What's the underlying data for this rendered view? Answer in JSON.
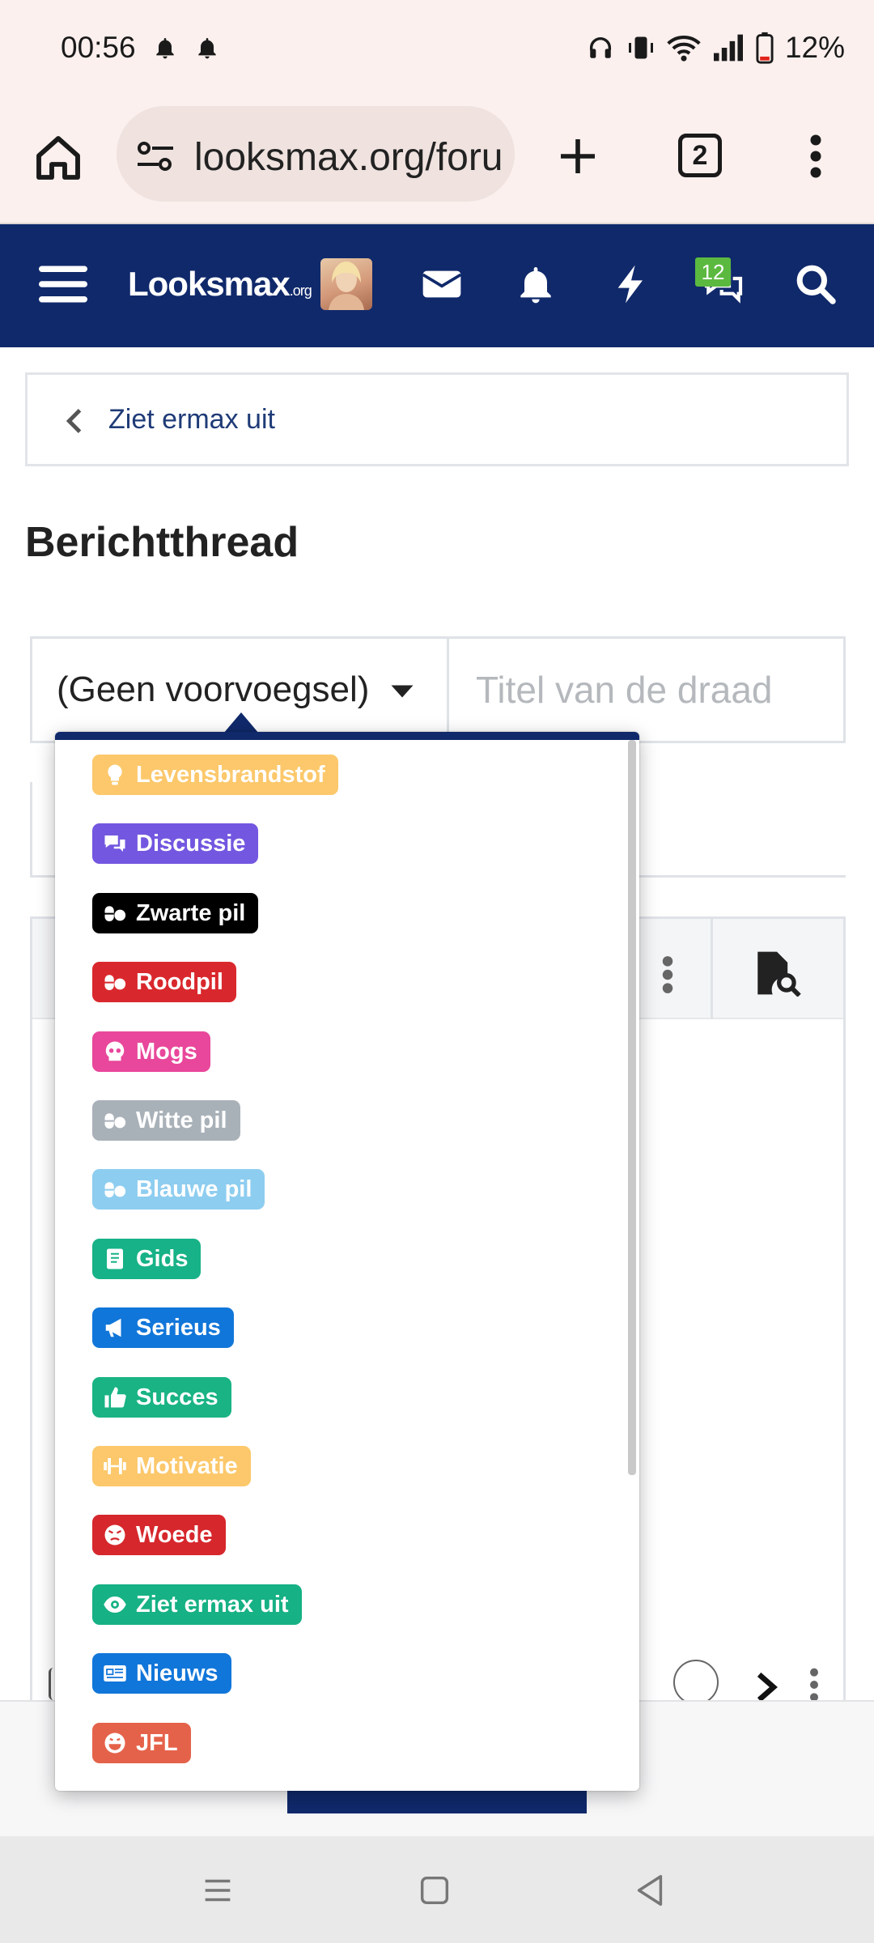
{
  "status_bar": {
    "time": "00:56",
    "battery": "12%"
  },
  "browser": {
    "url": "looksmax.org/foru",
    "tab_count": "2"
  },
  "site": {
    "logo": "Looksmax",
    "logo_suffix": ".org",
    "messages_badge": "12"
  },
  "breadcrumb": {
    "label": "Ziet ermax uit"
  },
  "page": {
    "title": "Berichtthread"
  },
  "form": {
    "prefix_value": "(Geen voorvoegsel)",
    "title_placeholder": "Titel van de draad"
  },
  "prefix_options": [
    {
      "label": "Levensbrandstof",
      "color": "#fcc86b",
      "icon": "lightbulb-icon"
    },
    {
      "label": "Discussie",
      "color": "#7357e0",
      "icon": "comments-icon"
    },
    {
      "label": "Zwarte pil",
      "color": "#000000",
      "icon": "pills-icon"
    },
    {
      "label": "Roodpil",
      "color": "#d9282d",
      "icon": "pills-icon"
    },
    {
      "label": "Mogs",
      "color": "#e8479b",
      "icon": "skull-icon"
    },
    {
      "label": "Witte pil",
      "color": "#a9b1b8",
      "icon": "pills-icon"
    },
    {
      "label": "Blauwe pil",
      "color": "#8dcdf0",
      "icon": "pills-icon"
    },
    {
      "label": "Gids",
      "color": "#17b287",
      "icon": "book-icon"
    },
    {
      "label": "Serieus",
      "color": "#1176d9",
      "icon": "megaphone-icon"
    },
    {
      "label": "Succes",
      "color": "#19b384",
      "icon": "thumbs-up-icon"
    },
    {
      "label": "Motivatie",
      "color": "#fcc86b",
      "icon": "dumbbell-icon"
    },
    {
      "label": "Woede",
      "color": "#d6272c",
      "icon": "angry-face-icon"
    },
    {
      "label": "Ziet ermax uit",
      "color": "#16b184",
      "icon": "eye-icon"
    },
    {
      "label": "Nieuws",
      "color": "#1176d9",
      "icon": "newspaper-icon"
    },
    {
      "label": "JFL",
      "color": "#e5624a",
      "icon": "laugh-icon"
    }
  ]
}
